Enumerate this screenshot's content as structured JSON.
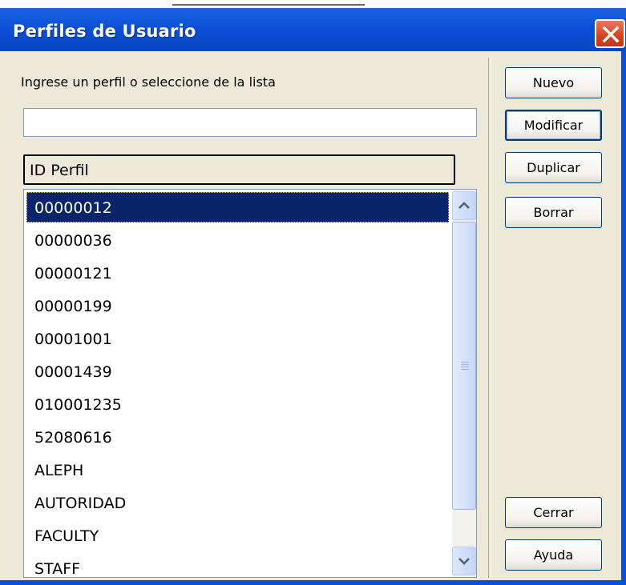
{
  "window": {
    "title": "Perfiles de Usuario"
  },
  "form": {
    "prompt": "Ingrese un perfil o seleccione de la lista",
    "input_value": "",
    "column_header": "ID Perfil"
  },
  "profiles": [
    {
      "id": "00000012",
      "selected": true
    },
    {
      "id": "00000036"
    },
    {
      "id": "00000121"
    },
    {
      "id": "00000199"
    },
    {
      "id": "00001001"
    },
    {
      "id": "00001439"
    },
    {
      "id": "010001235"
    },
    {
      "id": "52080616"
    },
    {
      "id": "ALEPH"
    },
    {
      "id": "AUTORIDAD"
    },
    {
      "id": "FACULTY"
    },
    {
      "id": "STAFF"
    }
  ],
  "buttons": {
    "nuevo": "Nuevo",
    "modificar": "Modificar",
    "duplicar": "Duplicar",
    "borrar": "Borrar",
    "cerrar": "Cerrar",
    "ayuda": "Ayuda"
  },
  "colors": {
    "titlebar": "#0a4fd6",
    "selection": "#0a246a",
    "dialog_bg": "#ece9d8",
    "close_button": "#d4421f"
  },
  "icons": {
    "close": "close-icon",
    "scroll_up": "chevron-up-icon",
    "scroll_down": "chevron-down-icon"
  }
}
